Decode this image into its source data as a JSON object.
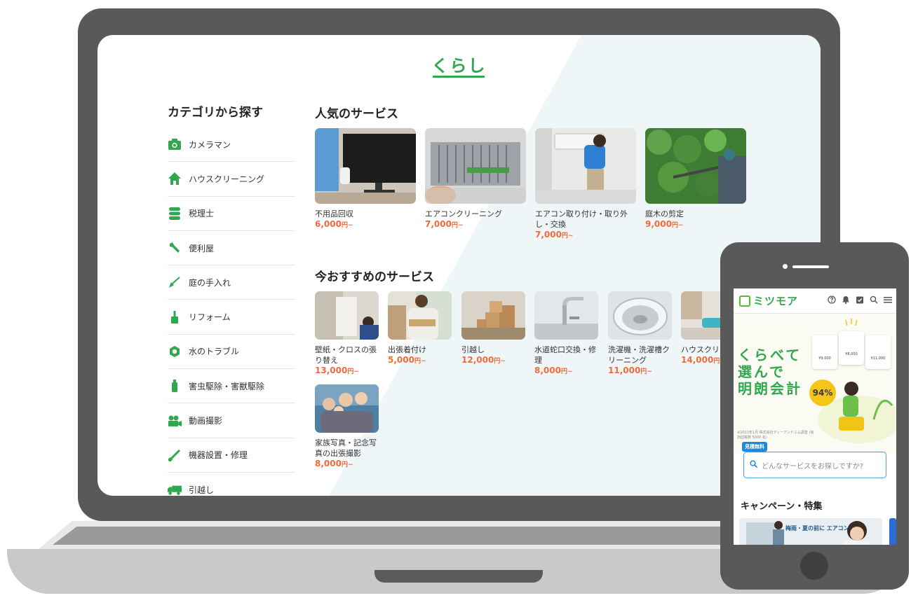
{
  "laptop": {
    "page_title": "くらし",
    "sidebar": {
      "heading": "カテゴリから探す",
      "items": [
        {
          "label": "カメラマン",
          "icon": "camera-icon"
        },
        {
          "label": "ハウスクリーニング",
          "icon": "house-icon"
        },
        {
          "label": "税理士",
          "icon": "database-icon"
        },
        {
          "label": "便利屋",
          "icon": "wrench-icon"
        },
        {
          "label": "庭の手入れ",
          "icon": "shovel-icon"
        },
        {
          "label": "リフォーム",
          "icon": "brush-icon"
        },
        {
          "label": "水のトラブル",
          "icon": "hexagon-icon"
        },
        {
          "label": "害虫駆除・害獣駆除",
          "icon": "spray-icon"
        },
        {
          "label": "動画撮影",
          "icon": "video-camera-icon"
        },
        {
          "label": "機器設置・修理",
          "icon": "screwdriver-icon"
        },
        {
          "label": "引越し",
          "icon": "truck-icon"
        }
      ]
    },
    "popular": {
      "heading": "人気のサービス",
      "items": [
        {
          "name": "不用品回収",
          "price": "6,000",
          "unit": "円~"
        },
        {
          "name": "エアコンクリーニング",
          "price": "7,000",
          "unit": "円~"
        },
        {
          "name": "エアコン取り付け・取り外し・交換",
          "price": "7,000",
          "unit": "円~"
        },
        {
          "name": "庭木の剪定",
          "price": "9,000",
          "unit": "円~"
        }
      ]
    },
    "recommended": {
      "heading": "今おすすめのサービス",
      "items": [
        {
          "name": "壁紙・クロスの張り替え",
          "price": "13,000",
          "unit": "円~"
        },
        {
          "name": "出張着付け",
          "price": "5,000",
          "unit": "円~"
        },
        {
          "name": "引越し",
          "price": "12,000",
          "unit": "円~"
        },
        {
          "name": "水道蛇口交換・修理",
          "price": "8,000",
          "unit": "円~"
        },
        {
          "name": "洗濯機・洗濯槽クリーニング",
          "price": "11,000",
          "unit": "円~"
        },
        {
          "name": "ハウスクリー",
          "price": "14,000",
          "unit": "円~"
        },
        {
          "name": "家族写真・記念写真の出張撮影",
          "price": "8,000",
          "unit": "円~"
        }
      ]
    }
  },
  "phone": {
    "logo": "ミツモア",
    "header_icons": [
      "help-icon",
      "bell-icon",
      "clipboard-icon",
      "search-icon",
      "menu-icon"
    ],
    "hero_lines": [
      "くらべて",
      "選んで",
      "明朗会計"
    ],
    "badge": "94%",
    "mini_prices": [
      "¥9,000",
      "¥8,000",
      "¥11,000"
    ],
    "note": "※2022年1月 株式会社ディーアンドエム調査 (有効回答数 5000 名)",
    "free_tag": "見積無料",
    "search_placeholder": "どんなサービスをお探しですか?",
    "campaign_heading": "キャンペーン・特集",
    "banner_text": "梅雨・夏の前に エアコン"
  },
  "colors": {
    "brand_green": "#2fa84f",
    "price_orange": "#f06a3d",
    "device_gray": "#595959",
    "accent_blue": "#1e88e5"
  }
}
